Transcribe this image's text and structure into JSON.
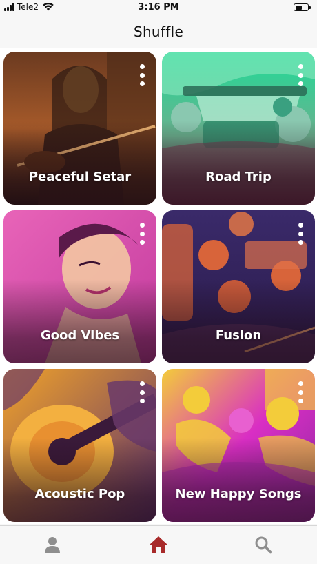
{
  "status_bar": {
    "carrier": "Tele2",
    "time": "3:16 PM",
    "icons": [
      "signal-bars-icon",
      "wifi-icon",
      "battery-icon"
    ]
  },
  "header": {
    "title": "Shuffle"
  },
  "playlists": [
    {
      "title": "Peaceful Setar",
      "palette": [
        "#2c1a12",
        "#8a4a26",
        "#e0964a"
      ],
      "more_icon": "more-vertical-icon"
    },
    {
      "title": "Road Trip",
      "palette": [
        "#1fdc98",
        "#6ab08e",
        "#7a3a52"
      ],
      "more_icon": "more-vertical-icon"
    },
    {
      "title": "Good Vibes",
      "palette": [
        "#e864b8",
        "#c23a9e",
        "#f3c6a2"
      ],
      "more_icon": "more-vertical-icon"
    },
    {
      "title": "Fusion",
      "palette": [
        "#33245e",
        "#d8643a",
        "#5a2a6a"
      ],
      "more_icon": "more-vertical-icon"
    },
    {
      "title": "Acoustic Pop",
      "palette": [
        "#f0a22a",
        "#5a2f6e",
        "#c45a3a"
      ],
      "more_icon": "more-vertical-icon"
    },
    {
      "title": "New Happy Songs",
      "palette": [
        "#d92ec4",
        "#f3cc3a",
        "#8a2aa0"
      ],
      "more_icon": "more-vertical-icon"
    }
  ],
  "tab_bar": {
    "tabs": [
      {
        "name": "profile",
        "icon": "person-icon",
        "active": false
      },
      {
        "name": "home",
        "icon": "home-icon",
        "active": true
      },
      {
        "name": "search",
        "icon": "search-icon",
        "active": false
      }
    ],
    "active_color": "#a82a2a",
    "inactive_color": "#8e8e8e"
  }
}
